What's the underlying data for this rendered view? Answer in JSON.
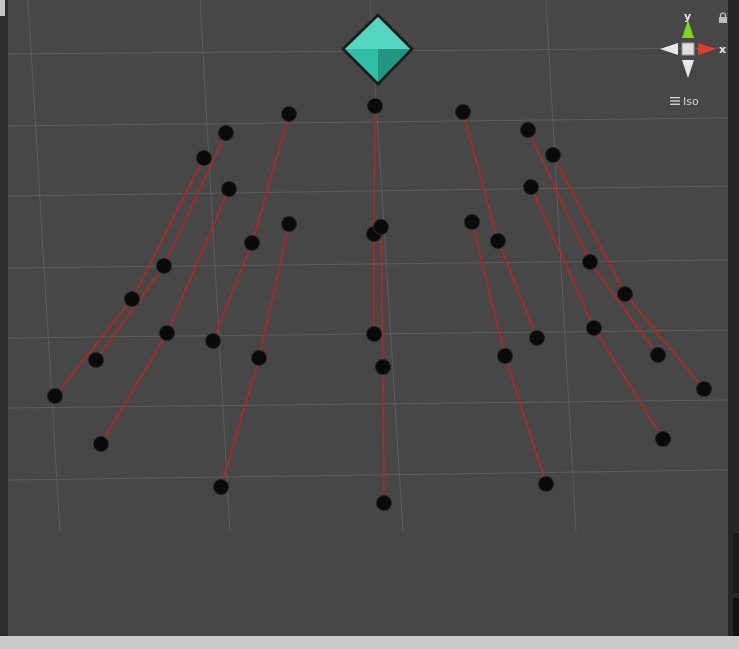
{
  "scene": {
    "background": "#474747",
    "grid_color": "#5c5c5c",
    "link_color": "#c62020",
    "joint_color": "#0a0a0a",
    "joint_outline": "#262626",
    "root_color": "#2fbfa6",
    "root_icon": "diamond-gem",
    "link_count": 10,
    "joint_count": 31
  },
  "gizmo": {
    "y_label": "y",
    "x_label": "x",
    "projection_label": "Iso",
    "y_axis_color": "#7ed321",
    "x_axis_color": "#e33a2e",
    "neutral_color": "#e8e8e8",
    "icons": [
      "lock-icon",
      "menu-icon"
    ]
  }
}
